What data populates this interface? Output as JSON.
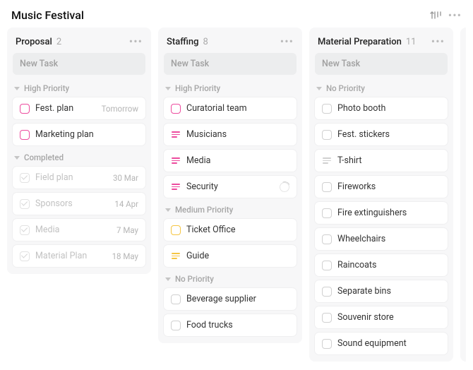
{
  "header": {
    "title": "Music Festival"
  },
  "new_task_placeholder": "New Task",
  "columns": [
    {
      "title": "Proposal",
      "count": "2",
      "groups": [
        {
          "label": "High Priority",
          "tasks": [
            {
              "title": "Fest. plan",
              "icon": "chk-pink",
              "due": "Tomorrow"
            },
            {
              "title": "Marketing plan",
              "icon": "chk-pink"
            }
          ]
        },
        {
          "label": "Completed",
          "tasks": [
            {
              "title": "Field plan",
              "icon": "done",
              "due": "30 Mar",
              "completed": true
            },
            {
              "title": "Sponsors",
              "icon": "done",
              "due": "14 Apr",
              "completed": true
            },
            {
              "title": "Media",
              "icon": "done",
              "due": "7 May",
              "completed": true
            },
            {
              "title": "Material Plan",
              "icon": "done",
              "due": "18 May",
              "completed": true
            }
          ]
        }
      ]
    },
    {
      "title": "Staffing",
      "count": "8",
      "groups": [
        {
          "label": "High Priority",
          "tasks": [
            {
              "title": "Curatorial team",
              "icon": "chk-pink"
            },
            {
              "title": "Musicians",
              "icon": "list-pink"
            },
            {
              "title": "Media",
              "icon": "list-pink"
            },
            {
              "title": "Security",
              "icon": "list-pink",
              "progress": true
            }
          ]
        },
        {
          "label": "Medium Priority",
          "tasks": [
            {
              "title": "Ticket Office",
              "icon": "chk-yellow"
            },
            {
              "title": "Guide",
              "icon": "list-yellow"
            }
          ]
        },
        {
          "label": "No Priority",
          "tasks": [
            {
              "title": "Beverage supplier",
              "icon": "chk-gray"
            },
            {
              "title": "Food trucks",
              "icon": "chk-gray"
            }
          ]
        }
      ]
    },
    {
      "title": "Material Preparation",
      "count": "11",
      "groups": [
        {
          "label": "No Priority",
          "tasks": [
            {
              "title": "Photo booth",
              "icon": "chk-gray"
            },
            {
              "title": "Fest. stickers",
              "icon": "chk-gray"
            },
            {
              "title": "T-shirt",
              "icon": "list-gray"
            },
            {
              "title": "Fireworks",
              "icon": "chk-gray"
            },
            {
              "title": "Fire extinguishers",
              "icon": "chk-gray"
            },
            {
              "title": "Wheelchairs",
              "icon": "chk-gray"
            },
            {
              "title": "Raincoats",
              "icon": "chk-gray"
            },
            {
              "title": "Separate bins",
              "icon": "chk-gray"
            },
            {
              "title": "Souvenir store",
              "icon": "chk-gray"
            },
            {
              "title": "Sound equipment",
              "icon": "chk-gray"
            }
          ]
        }
      ]
    }
  ]
}
